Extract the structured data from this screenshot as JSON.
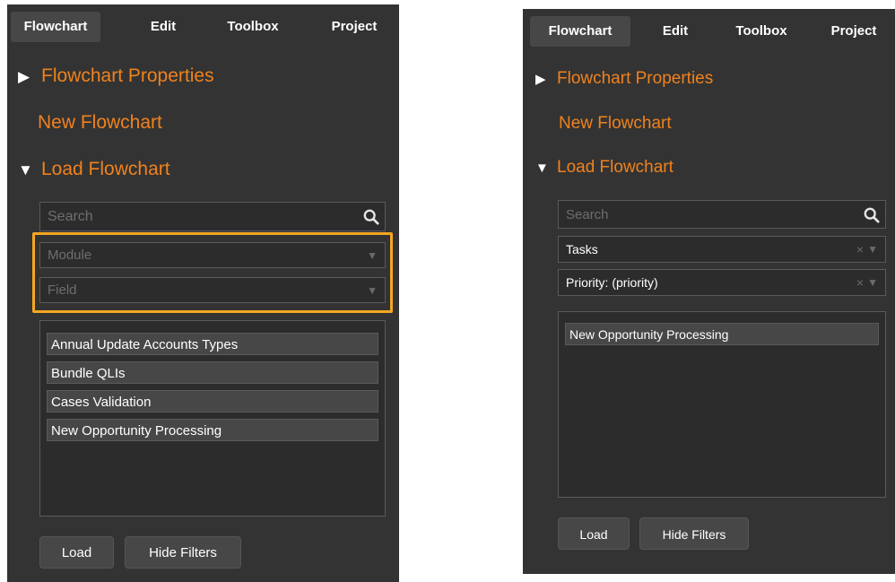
{
  "colors": {
    "panel_bg": "#333333",
    "accent": "#f0821e",
    "highlight": "#f5a623"
  },
  "panels": [
    {
      "tabs": [
        "Flowchart",
        "Edit",
        "Toolbox",
        "Project"
      ],
      "active_tab": "Flowchart",
      "sections": {
        "properties": {
          "arrow": "▶",
          "label": "Flowchart Properties"
        },
        "new": {
          "label": "New Flowchart"
        },
        "load": {
          "arrow": "▼",
          "label": "Load Flowchart"
        }
      },
      "search": {
        "placeholder": "Search",
        "icon": "search-icon"
      },
      "filters": {
        "module": {
          "value": "Module",
          "is_placeholder": true
        },
        "field": {
          "value": "Field",
          "is_placeholder": true
        }
      },
      "list_items": [
        "Annual Update Accounts Types",
        "Bundle QLIs",
        "Cases Validation",
        "New Opportunity Processing"
      ],
      "buttons": {
        "load": "Load",
        "hide_filters": "Hide Filters"
      }
    },
    {
      "tabs": [
        "Flowchart",
        "Edit",
        "Toolbox",
        "Project"
      ],
      "active_tab": "Flowchart",
      "sections": {
        "properties": {
          "arrow": "▶",
          "label": "Flowchart Properties"
        },
        "new": {
          "label": "New Flowchart"
        },
        "load": {
          "arrow": "▼",
          "label": "Load Flowchart"
        }
      },
      "search": {
        "placeholder": "Search",
        "icon": "search-icon"
      },
      "filters": {
        "module": {
          "value": "Tasks",
          "is_placeholder": false,
          "clear": "×"
        },
        "field": {
          "value": "Priority: (priority)",
          "is_placeholder": false,
          "clear": "×"
        }
      },
      "list_items": [
        "New Opportunity Processing"
      ],
      "buttons": {
        "load": "Load",
        "hide_filters": "Hide Filters"
      }
    }
  ],
  "dropdown_arrow": "▼"
}
